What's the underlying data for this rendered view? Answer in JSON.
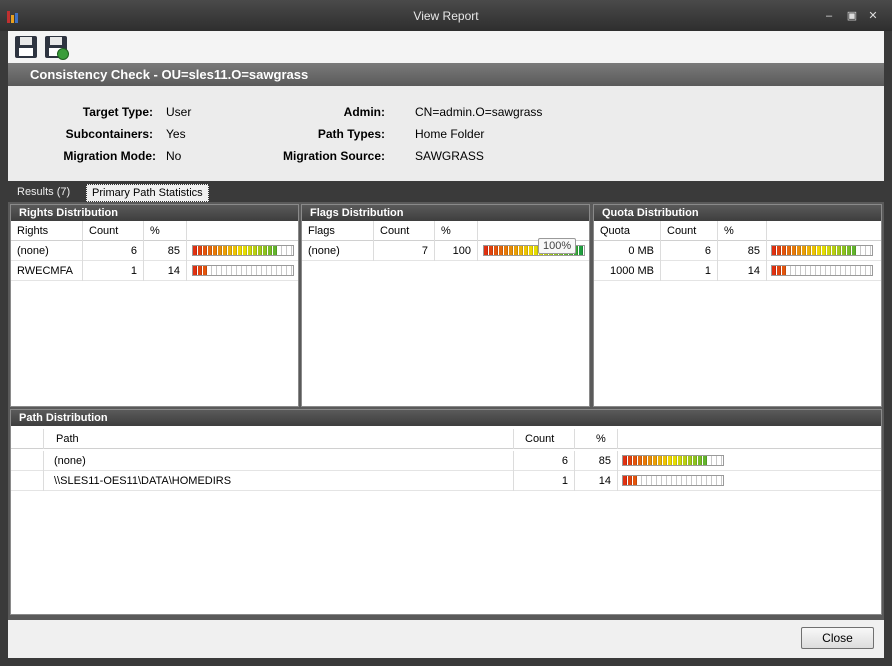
{
  "window": {
    "title": "View Report"
  },
  "header": {
    "title": "Consistency Check - OU=sles11.O=sawgrass"
  },
  "summary": {
    "target_type_label": "Target Type:",
    "target_type_value": "User",
    "subcontainers_label": "Subcontainers:",
    "subcontainers_value": "Yes",
    "migration_mode_label": "Migration Mode:",
    "migration_mode_value": "No",
    "admin_label": "Admin:",
    "admin_value": "CN=admin.O=sawgrass",
    "path_types_label": "Path Types:",
    "path_types_value": "Home Folder",
    "migration_source_label": "Migration Source:",
    "migration_source_value": "SAWGRASS"
  },
  "tabs": {
    "results": "Results  (7)",
    "primary": "Primary Path Statistics"
  },
  "rights": {
    "title": "Rights Distribution",
    "col_rights": "Rights",
    "col_count": "Count",
    "col_pct": "%",
    "rows": [
      {
        "name": "(none)",
        "count": "6",
        "pct": "85",
        "fill": 0.85
      },
      {
        "name": "RWECMFA",
        "count": "1",
        "pct": "14",
        "fill": 0.14
      }
    ]
  },
  "flags": {
    "title": "Flags Distribution",
    "col_flags": "Flags",
    "col_count": "Count",
    "col_pct": "%",
    "rows": [
      {
        "name": "(none)",
        "count": "7",
        "pct": "100",
        "fill": 1.0
      }
    ],
    "tooltip": "100%"
  },
  "quota": {
    "title": "Quota Distribution",
    "col_quota": "Quota",
    "col_count": "Count",
    "col_pct": "%",
    "rows": [
      {
        "name": "0 MB",
        "count": "6",
        "pct": "85",
        "fill": 0.85
      },
      {
        "name": "1000 MB",
        "count": "1",
        "pct": "14",
        "fill": 0.14
      }
    ]
  },
  "paths": {
    "title": "Path Distribution",
    "col_path": "Path",
    "col_count": "Count",
    "col_pct": "%",
    "rows": [
      {
        "name": "(none)",
        "count": "6",
        "pct": "85",
        "fill": 0.85
      },
      {
        "name": "\\\\SLES11-OES11\\DATA\\HOMEDIRS",
        "count": "1",
        "pct": "14",
        "fill": 0.14
      }
    ]
  },
  "footer": {
    "close_label": "Close"
  },
  "colors": {
    "bar_low": "#e03010",
    "bar_mid": "#f0e000",
    "bar_high": "#20a040"
  },
  "icons": {
    "save": "save-icon",
    "save_as": "save-as-icon"
  }
}
